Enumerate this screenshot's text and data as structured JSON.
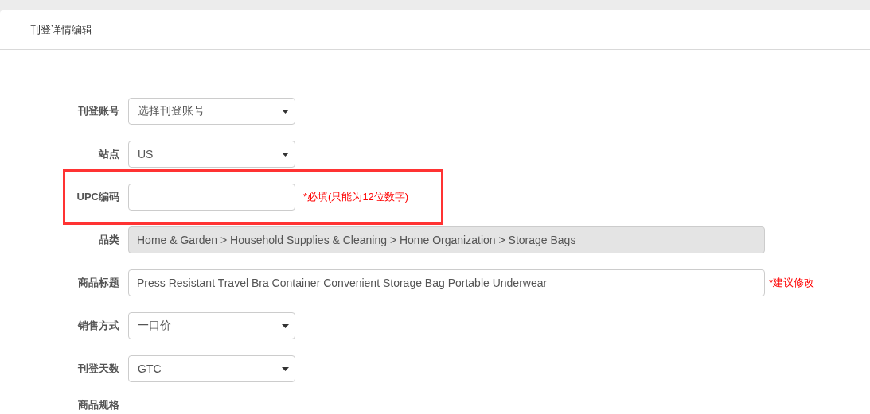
{
  "panel": {
    "title": "刊登详情编辑"
  },
  "fields": [
    {
      "label": "刊登账号",
      "kind": "select",
      "value": "选择刊登账号"
    },
    {
      "label": "站点",
      "kind": "select",
      "value": "US"
    },
    {
      "label": "UPC编码",
      "kind": "text",
      "note": "*必填(只能为12位数字)",
      "highlighted": true
    },
    {
      "label": "品类",
      "kind": "readonly",
      "value": "Home & Garden > Household Supplies & Cleaning > Home Organization > Storage Bags"
    },
    {
      "label": "商品标题",
      "kind": "text",
      "wide": true,
      "value": "Press Resistant Travel Bra Container Convenient Storage Bag Portable Underwear",
      "note": "*建议修改"
    },
    {
      "label": "销售方式",
      "kind": "select",
      "value": "一口价"
    },
    {
      "label": "刊登天数",
      "kind": "select",
      "value": "GTC"
    },
    {
      "label": "商品规格",
      "kind": "heading"
    }
  ]
}
